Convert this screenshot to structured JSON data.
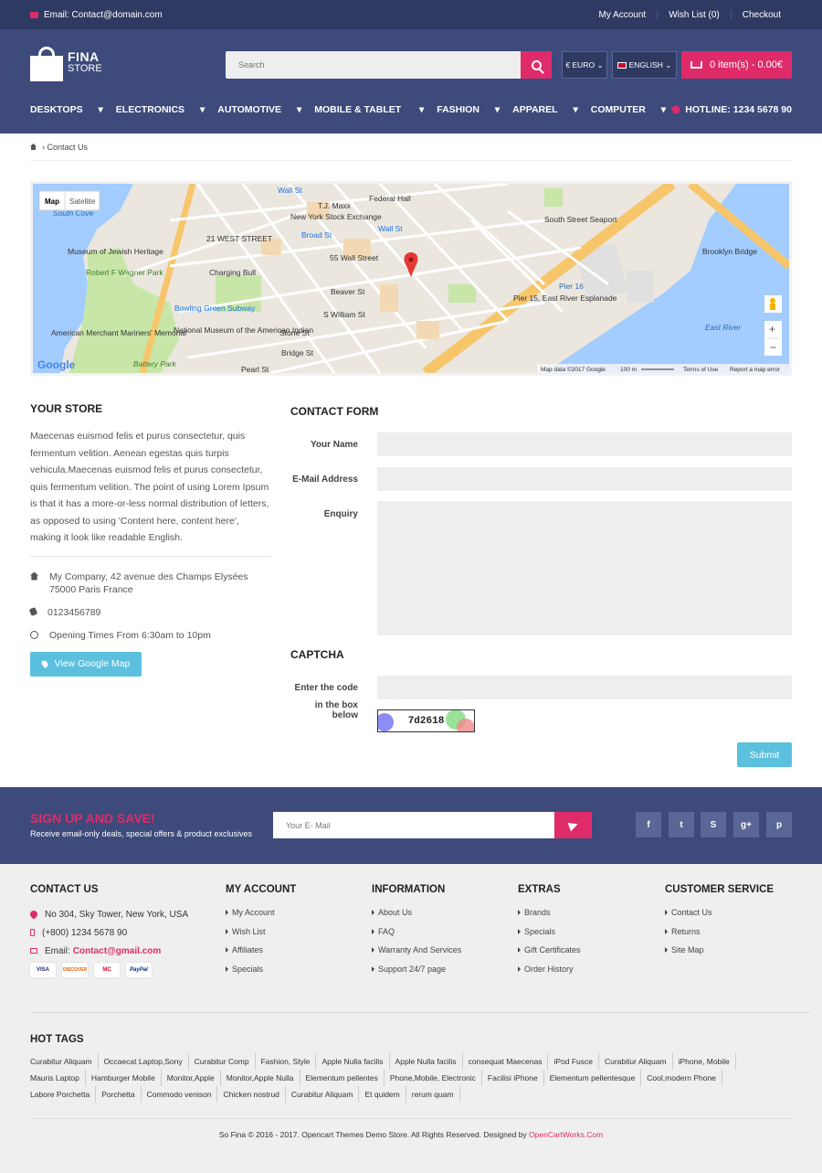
{
  "topbar": {
    "email": "Email: Contact@domain.com",
    "my_account": "My Account",
    "wish_list": "Wish List (0)",
    "checkout": "Checkout"
  },
  "header": {
    "logo_line1": "FINA",
    "logo_line2": "STORE",
    "search_placeholder": "Search",
    "currency": "€ EURO",
    "language": "ENGLISH",
    "cart": "0 item(s) - 0.00€",
    "hotline": "HOTLINE: 1234 5678 90"
  },
  "nav": [
    "DESKTOPS",
    "ELECTRONICS",
    "AUTOMOTIVE",
    "MOBILE & TABLET",
    "FASHION",
    "APPAREL",
    "COMPUTER"
  ],
  "breadcrumb": {
    "current": "Contact Us"
  },
  "map": {
    "tab_map": "Map",
    "tab_satellite": "Satellite",
    "labels": [
      "South Cove",
      "Wall St",
      "Federal Hall",
      "T.J. Maxx",
      "New York Stock Exchange",
      "21 WEST STREET",
      "Broad St",
      "Wall St",
      "South Street Seaport",
      "Brooklyn Bridge",
      "Museum of Jewish Heritage",
      "Charging Bull",
      "55 Wall Street",
      "Robert F Wagner Park",
      "Pier 15, East River Esplanade",
      "Pier 16",
      "Bowling Green Subway",
      "Beaver St",
      "S William St",
      "Stone St",
      "American Merchant Mariners' Memorial",
      "National Museum of the American Indian",
      "Bridge St",
      "Battery Park",
      "Pearl St",
      "East River",
      "Brooklyn Bridge"
    ],
    "footer_text": "Map data ©2017 Google",
    "scale": "100 m",
    "terms": "Terms of Use",
    "report": "Report a map error",
    "google": "Google"
  },
  "store": {
    "title": "YOUR STORE",
    "description": "Maecenas euismod felis et purus consectetur, quis fermentum velition. Aenean egestas quis turpis vehicula.Maecenas euismod felis et purus consectetur, quis fermentum velition. The point of using Lorem Ipsum is that it has a more-or-less normal distribution of letters, as opposed to using 'Content here, content here', making it look like readable English.",
    "address": "My Company, 42 avenue des Champs Elysées 75000 Paris France",
    "phone": "0123456789",
    "hours": "Opening Times From 6:30am to 10pm",
    "map_button": "View Google Map"
  },
  "form": {
    "title": "CONTACT FORM",
    "name_label": "Your Name",
    "email_label": "E-Mail Address",
    "enquiry_label": "Enquiry",
    "captcha_title": "CAPTCHA",
    "captcha_label_1": "Enter the code",
    "captcha_label_2": "in the box below",
    "captcha_code": "7d2618",
    "submit": "Submit"
  },
  "newsletter": {
    "title": "SIGN UP AND SAVE!",
    "subtitle": "Receive email-only deals, special offers & product exclusives",
    "placeholder": "Your E- Mail",
    "social": [
      "f",
      "t",
      "S",
      "g+",
      "p"
    ]
  },
  "footer": {
    "contact": {
      "title": "CONTACT US",
      "address": "No 304, Sky Tower, New York, USA",
      "phone": "(+800) 1234 5678 90",
      "email_label": "Email:",
      "email": "Contact@gmail.com",
      "cards": [
        "VISA",
        "DISCOVER",
        "MC",
        "PayPal"
      ]
    },
    "my_account": {
      "title": "MY ACCOUNT",
      "items": [
        "My Account",
        "Wish List",
        "Affiliates",
        "Specials"
      ]
    },
    "information": {
      "title": "INFORMATION",
      "items": [
        "About Us",
        "FAQ",
        "Warranty And Services",
        "Support 24/7 page"
      ]
    },
    "extras": {
      "title": "EXTRAS",
      "items": [
        "Brands",
        "Specials",
        "Gift Certificates",
        "Order History"
      ]
    },
    "customer_service": {
      "title": "CUSTOMER SERVICE",
      "items": [
        "Contact Us",
        "Returns",
        "Site Map"
      ]
    },
    "hot_tags": {
      "title": "HOT TAGS",
      "tags": [
        "Curabitur Aliquam",
        "Occaecat Laptop,Sony",
        "Curabitur Comp",
        "Fashion, Style",
        "Apple Nulla facilis",
        "Apple Nulla facilis",
        "consequat Maecenas",
        "iPod Fusce",
        "Curabitur Aliquam",
        "iPhone, Mobile",
        "Mauris Laptop",
        "Hamburger Mobile",
        "Monitor,Apple",
        "Monitor,Apple Nulla",
        "Elementum pellentes",
        "Phone,Mobile, Electronic",
        "Facilisi iPhone",
        "Elementum pellentesque",
        "Cool,modern Phone",
        "Labore Porchetta",
        "Porchetta",
        "Commodo venison",
        "Chicken nostrud",
        "Curabitur Aliquam",
        "Et quidem",
        "rerum quam"
      ]
    },
    "copyright": "So Fina © 2016 - 2017. Opencart Themes Demo Store. All Rights Reserved. Designed by",
    "designer": "OpenCartWorks.Com"
  },
  "colors": {
    "accent": "#e02b6a",
    "navy": "#3d4a7b",
    "cyan": "#5bc0de"
  }
}
